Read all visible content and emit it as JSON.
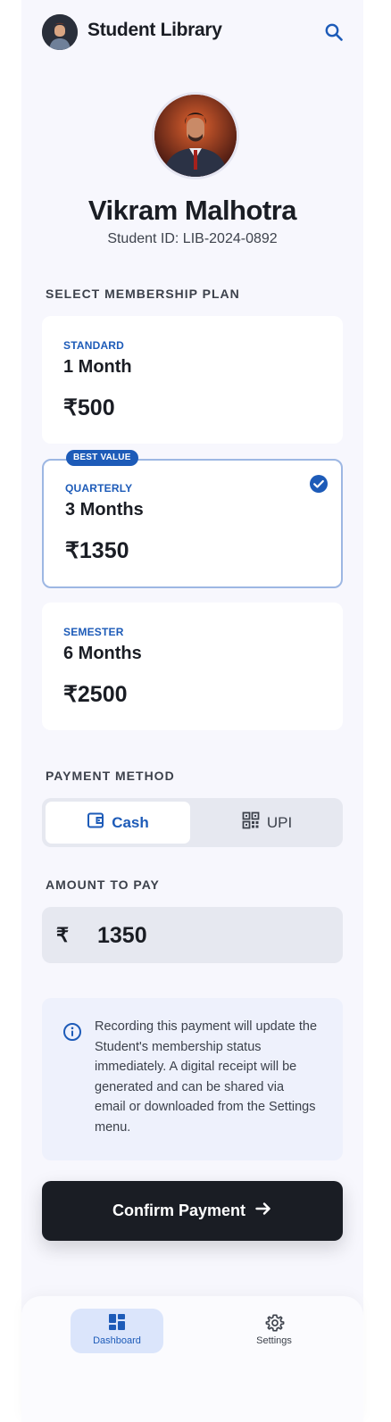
{
  "header": {
    "title": "Student Library"
  },
  "profile": {
    "name": "Vikram Malhotra",
    "student_id": "Student ID: LIB-2024-0892"
  },
  "membership": {
    "section_label": "SELECT MEMBERSHIP PLAN",
    "plans": [
      {
        "tag": "STANDARD",
        "duration": "1 Month",
        "price": "₹500"
      },
      {
        "tag": "QUARTERLY",
        "duration": "3 Months",
        "price": "₹1350",
        "badge": "BEST VALUE",
        "selected": true
      },
      {
        "tag": "SEMESTER",
        "duration": "6 Months",
        "price": "₹2500"
      }
    ]
  },
  "payment": {
    "section_label": "PAYMENT METHOD",
    "options": [
      {
        "label": "Cash",
        "icon": "wallet-icon",
        "active": true
      },
      {
        "label": "UPI",
        "icon": "qr-code-icon",
        "active": false
      }
    ]
  },
  "amount": {
    "section_label": "AMOUNT TO PAY",
    "symbol": "₹",
    "value": "1350"
  },
  "info": {
    "icon": "info-icon",
    "text": "Recording this payment will update the Student's membership status immediately. A digital receipt will be generated and can be shared via email or downloaded from the Settings menu."
  },
  "confirm": {
    "label": "Confirm Payment"
  },
  "nav": {
    "items": [
      {
        "label": "Dashboard",
        "icon": "dashboard-icon",
        "active": true
      },
      {
        "label": "Settings",
        "icon": "gear-icon",
        "active": false
      }
    ]
  },
  "colors": {
    "accent": "#1d5bb8",
    "primary_button": "#1a1d24",
    "background": "#f7f7fd"
  }
}
